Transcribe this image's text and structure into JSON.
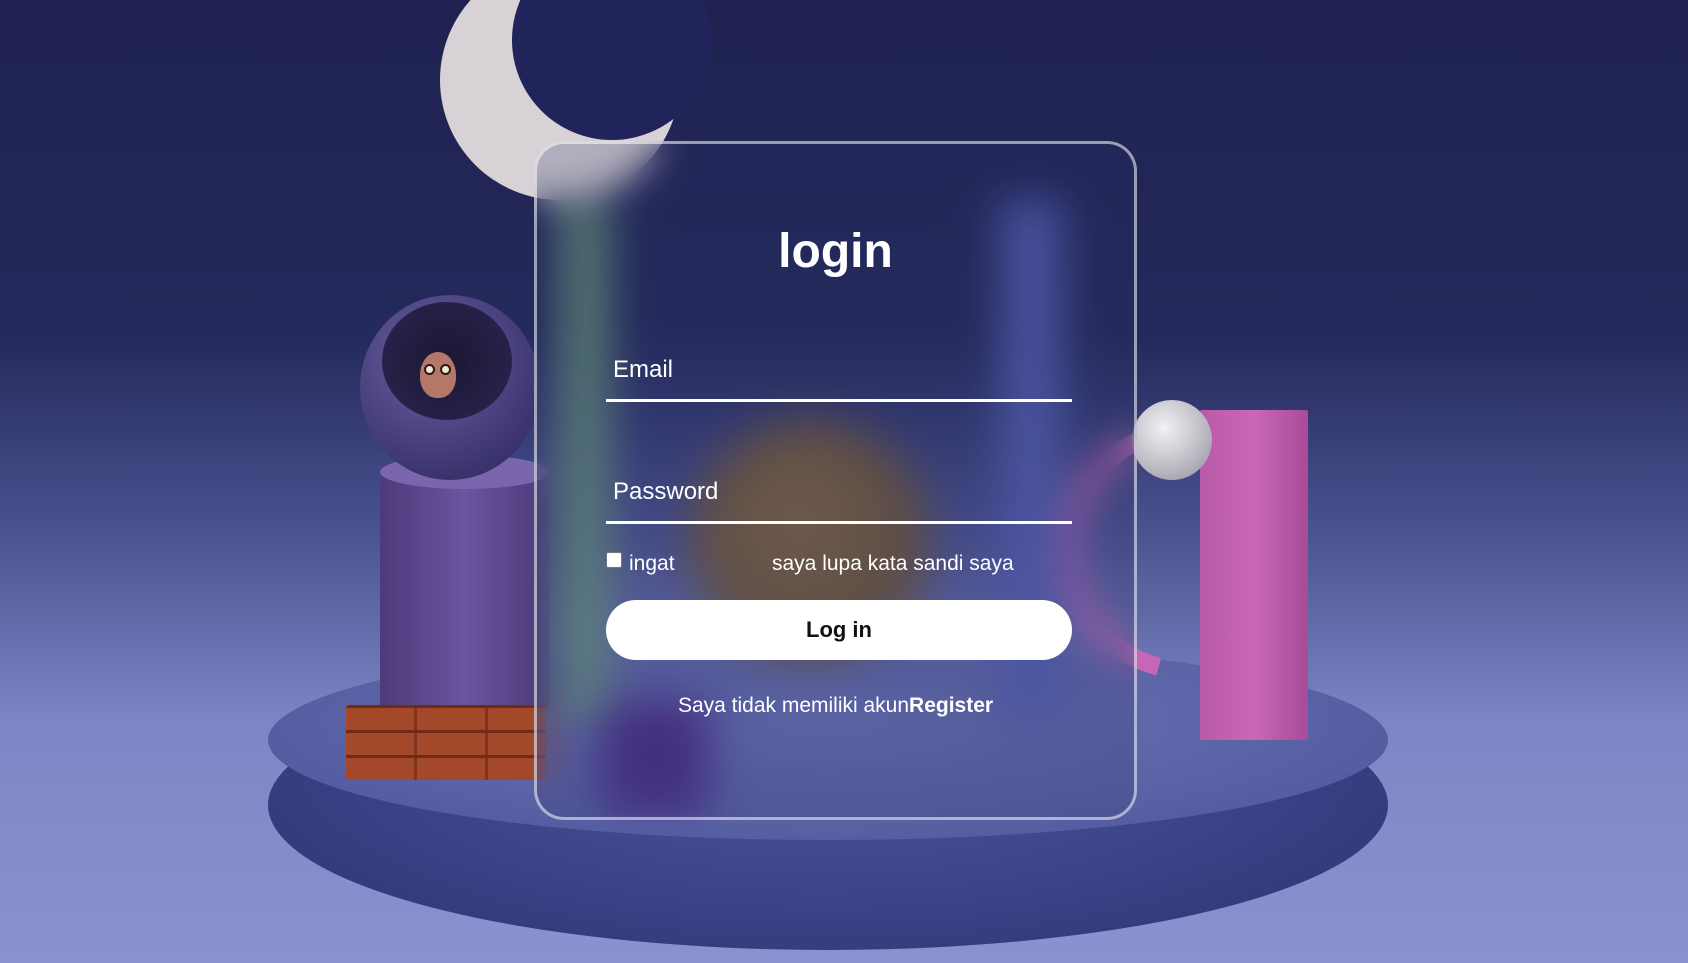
{
  "login_card": {
    "title": "login",
    "email": {
      "placeholder": "Email",
      "value": ""
    },
    "password": {
      "placeholder": "Password",
      "value": ""
    },
    "remember": {
      "label": "ingat",
      "checked": false
    },
    "forgot_password_label": "saya lupa kata sandi saya",
    "login_button_label": "Log in",
    "register_prompt": "Saya tidak memiliki akun",
    "register_link_label": "Register"
  },
  "colors": {
    "background_top": "#1f2250",
    "background_bottom": "#8a93cf",
    "card_border": "#ffffff",
    "button_background": "#ffffff",
    "button_text": "#111111",
    "text": "#ffffff"
  }
}
